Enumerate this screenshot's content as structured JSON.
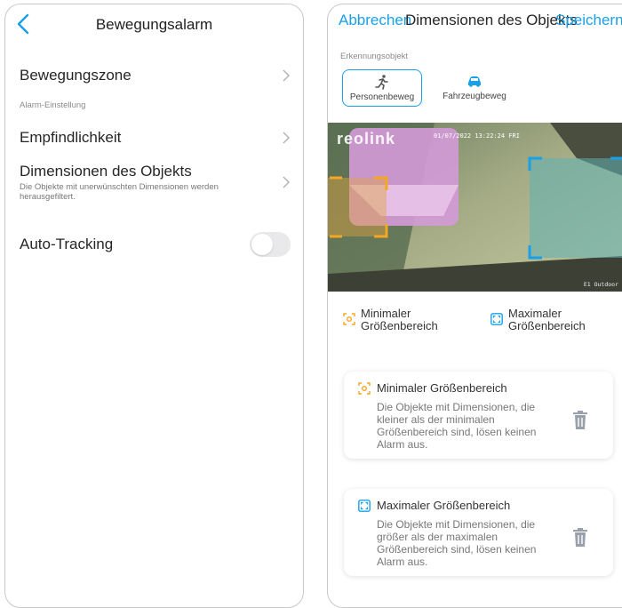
{
  "left": {
    "title": "Bewegungsalarm",
    "items": [
      {
        "label": "Bewegungszone"
      },
      {
        "section": "Alarm-Einstellung"
      },
      {
        "label": "Empfindlichkeit"
      },
      {
        "label": "Dimensionen des Objekts",
        "description": "Die Objekte mit unerwünschten Dimensionen werden herausgefiltert."
      },
      {
        "label": "Auto-Tracking",
        "toggle": false
      }
    ]
  },
  "right": {
    "cancel": "Abbrechen",
    "title": "Dimensionen des Objekts",
    "save": "Speichern",
    "detection_label": "Erkennungsobjekt",
    "objects": [
      {
        "label": "Personenbeweg",
        "icon": "person-running-icon",
        "selected": true
      },
      {
        "label": "Fahrzeugbeweg",
        "icon": "car-icon",
        "selected": false
      }
    ],
    "camera": {
      "brand": "reolink",
      "timestamp": "01/07/2022 13:22:24 FRI",
      "camera_label": "E1 Outdoor"
    },
    "legend": {
      "min": "Minimaler Größenbereich",
      "max": "Maximaler Größenbereich"
    },
    "cards": [
      {
        "title": "Minimaler Größenbereich",
        "description": "Die Objekte mit Dimensionen, die kleiner als der minimalen Größenbereich sind, lösen keinen Alarm aus.",
        "icon": "min-size-icon"
      },
      {
        "title": "Maximaler Größenbereich",
        "description": "Die Objekte mit Dimensionen, die größer als der maximalen Größenbereich sind, lösen keinen Alarm aus.",
        "icon": "max-size-icon"
      }
    ],
    "colors": {
      "accent": "#1aa0e8",
      "min": "#f5a623",
      "max": "#1aa0e8"
    }
  }
}
